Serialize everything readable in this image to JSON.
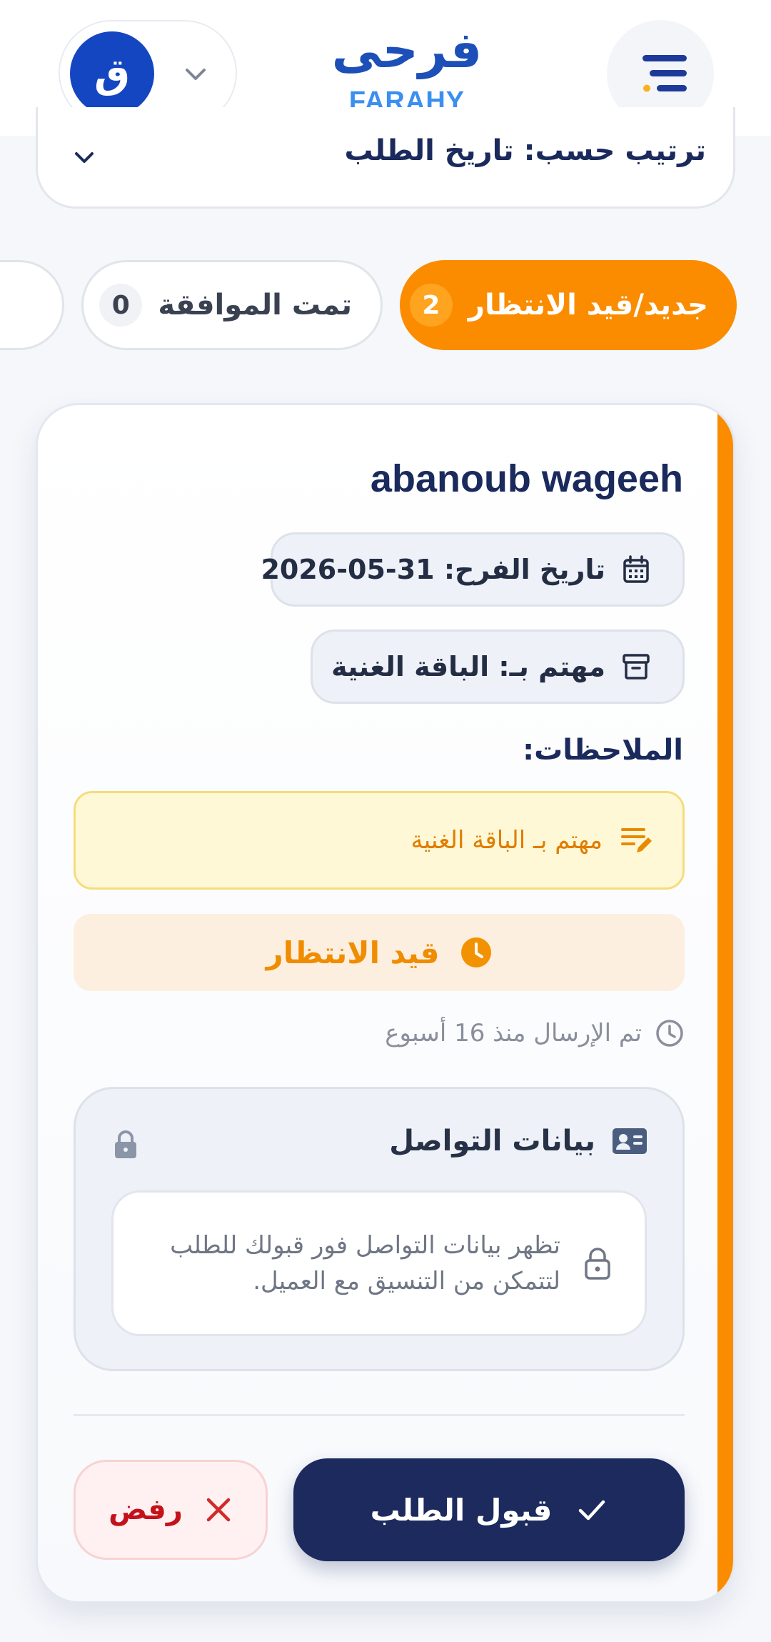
{
  "header": {
    "logo_ar": "فرحى",
    "logo_en": "FARAHY",
    "avatar_letter": "ق"
  },
  "sort": {
    "label": "ترتيب حسب: تاريخ الطلب"
  },
  "tabs": [
    {
      "label": "جديد/قيد الانتظار",
      "count": "2",
      "active": true
    },
    {
      "label": "تمت الموافقة",
      "count": "0",
      "active": false
    }
  ],
  "card": {
    "client_name": "abanoub wageeh",
    "wedding_date": "تاريخ الفرح: 31-05-2026",
    "interested_in": "مهتم بـ: الباقة الغنية",
    "notes_title": "الملاحظات:",
    "note_text": "مهتم بـ الباقة الغنية",
    "status": "قيد الانتظار",
    "sent_time": "تم الإرسال منذ 16 أسبوع",
    "contact_title": "بيانات التواصل",
    "contact_line1": "تظهر بيانات التواصل فور قبولك للطلب",
    "contact_line2": "لتتمكن من التنسيق مع العميل.",
    "accept_label": "قبول الطلب",
    "reject_label": "رفض"
  },
  "colors": {
    "accent_orange": "#fb8c00",
    "primary_navy": "#1c2a5e",
    "brand_blue": "#1446c2",
    "reject_red": "#c4121b"
  }
}
